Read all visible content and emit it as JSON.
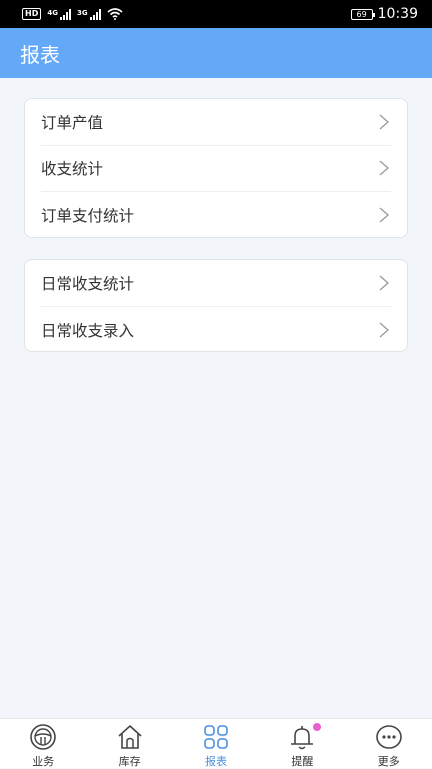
{
  "status_bar": {
    "hd": "HD",
    "net1": "4G",
    "net2": "3G",
    "battery": "69",
    "time": "10:39"
  },
  "header": {
    "title": "报表"
  },
  "group1": {
    "items": [
      {
        "label": "订单产值"
      },
      {
        "label": "收支统计"
      },
      {
        "label": "订单支付统计"
      }
    ]
  },
  "group2": {
    "items": [
      {
        "label": "日常收支统计"
      },
      {
        "label": "日常收支录入"
      }
    ]
  },
  "tabbar": {
    "items": [
      {
        "label": "业务",
        "icon": "steering-wheel-icon"
      },
      {
        "label": "库存",
        "icon": "home-icon"
      },
      {
        "label": "报表",
        "icon": "grid-icon",
        "active": true
      },
      {
        "label": "提醒",
        "icon": "bell-icon",
        "badge": true
      },
      {
        "label": "更多",
        "icon": "more-icon"
      }
    ],
    "active_color": "#4a8fe0",
    "badge_color": "#e85fd0"
  },
  "colors": {
    "header": "#64a8f8",
    "background": "#f2f5f9"
  }
}
